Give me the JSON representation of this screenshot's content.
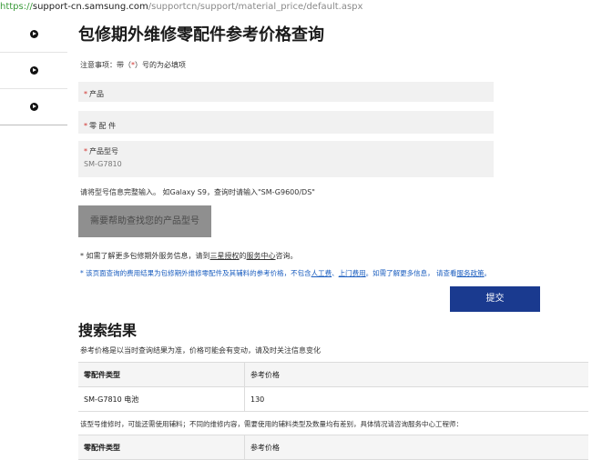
{
  "url": {
    "scheme": "https://",
    "host": "support-cn.samsung.com",
    "path": "/supportcn/support/material_price/default.aspx"
  },
  "sidebar": {
    "items": [
      {
        "icon": "arrow-right-circle-icon"
      },
      {
        "icon": "arrow-right-circle-icon"
      },
      {
        "icon": "arrow-right-circle-icon"
      }
    ]
  },
  "page": {
    "title": "包修期外维修零配件参考价格查询",
    "notice_prefix": "注意事项：带（",
    "notice_star": "*",
    "notice_suffix": "）号的为必填项"
  },
  "form": {
    "product": {
      "star": "*",
      "label": "产品"
    },
    "part": {
      "star": "*",
      "label": "零 配 件"
    },
    "model": {
      "star": "*",
      "label": "产品型号",
      "value": "SM-G7810"
    },
    "hint": "请将型号信息完整输入。 如Galaxy S9，查询时请输入\"SM-G9600/DS\"",
    "help_button": "需要帮助查找您的产品型号",
    "info1_prefix": "* 如需了解更多包修期外服务信息，请到",
    "info1_link1": "三星授权",
    "info1_mid": "的",
    "info1_link2": "服务中心",
    "info1_suffix": "咨询。",
    "info2_text1": "* 该页面查询的费用结果为包修期外维修零配件及其辅料的参考价格，不包含",
    "info2_link1": "人工费",
    "info2_sep": "、",
    "info2_link2": "上门费用",
    "info2_text2": "。如需了解更多信息， 请查看",
    "info2_link3": "服务政策",
    "info2_text3": "。",
    "submit": "提交"
  },
  "results": {
    "title": "搜索结果",
    "note": "参考价格是以当时查询结果为准，价格可能会有变动，请及时关注信息变化",
    "table1": {
      "headers": [
        "零配件类型",
        "参考价格"
      ],
      "rows": [
        [
          "SM-G7810 电池",
          "130"
        ]
      ]
    },
    "note2": "该型号维修时，可能还需使用辅料；不同的维修内容，需要使用的辅料类型及数量均有差别，具体情况请咨询服务中心工程师：",
    "table2": {
      "headers": [
        "零配件类型",
        "参考价格"
      ]
    }
  },
  "colors": {
    "accent": "#1a3a8f",
    "required": "#d0312d",
    "link_blue": "#1a5dbf",
    "help_button": "#8f8f8f"
  }
}
